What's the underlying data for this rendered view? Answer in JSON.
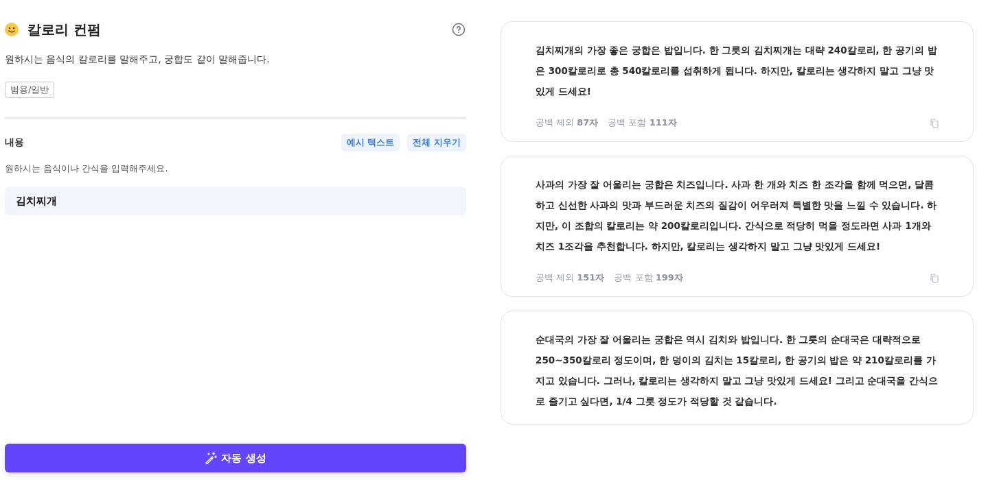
{
  "header": {
    "title": "칼로리 컨펌",
    "description": "원하시는 음식의 칼로리를 말해주고, 궁합도 같이 말해줍니다.",
    "tag": "범용/일반"
  },
  "input": {
    "label": "내용",
    "actions": [
      "예시 텍스트",
      "전체 지우기"
    ],
    "hint": "원하시는 음식이나 간식을 입력해주세요.",
    "value": "김치찌개"
  },
  "generate_button": "자동 생성",
  "results": [
    {
      "text": "김치찌개의 가장 좋은 궁합은 밥입니다. 한 그릇의 김치찌개는 대략 240칼로리, 한 공기의 밥은 300칼로리로 총 540칼로리를 섭취하게 됩니다. 하지만, 칼로리는 생각하지 말고 그냥 맛있게 드세요!",
      "counts": [
        {
          "label": "공백 제외",
          "value": "87자"
        },
        {
          "label": "공백 포함",
          "value": "111자"
        }
      ]
    },
    {
      "text": "사과의 가장 잘 어울리는 궁합은 치즈입니다. 사과 한 개와 치즈 한 조각을 함께 먹으면, 달콤하고 신선한 사과의 맛과 부드러운 치즈의 질감이 어우러져 특별한 맛을 느낄 수 있습니다. 하지만, 이 조합의 칼로리는 약 200칼로리입니다. 간식으로 적당히 먹을 정도라면 사과 1개와 치즈 1조각을 추천합니다. 하지만, 칼로리는 생각하지 말고 그냥 맛있게 드세요!",
      "counts": [
        {
          "label": "공백 제외",
          "value": "151자"
        },
        {
          "label": "공백 포함",
          "value": "199자"
        }
      ]
    },
    {
      "text": "순대국의 가장 잘 어울리는 궁합은 역시 김치와 밥입니다. 한 그릇의 순대국은 대략적으로 250~350칼로리 정도이며, 한 덩이의 김치는 15칼로리, 한 공기의 밥은 약 210칼로리를 가지고 있습니다. 그러나, 칼로리는 생각하지 말고 그냥 맛있게 드세요! 그리고 순대국을 간식으로 즐기고 싶다면, 1/4 그릇 정도가 적당할 것 같습니다."
    }
  ]
}
